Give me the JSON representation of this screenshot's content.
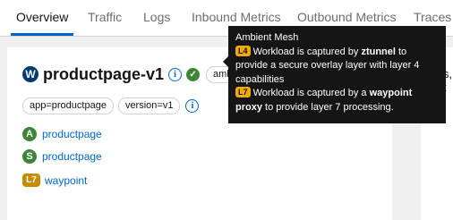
{
  "tabs": [
    {
      "label": "Overview",
      "active": true
    },
    {
      "label": "Traffic"
    },
    {
      "label": "Logs"
    },
    {
      "label": "Inbound Metrics"
    },
    {
      "label": "Outbound Metrics"
    },
    {
      "label": "Traces"
    }
  ],
  "workload": {
    "badge": "W",
    "name": "productpage-v1",
    "info_icon": "i",
    "status_icon": "✓",
    "ambient_label": "ambient",
    "labels": [
      "app=productpage",
      "version=v1"
    ]
  },
  "services": [
    {
      "badge": "A",
      "name": "productpage"
    },
    {
      "badge": "S",
      "name": "productpage"
    },
    {
      "badge": "L7",
      "name": "waypoint"
    }
  ],
  "tooltip": {
    "title": "Ambient Mesh",
    "l4_badge": "L4",
    "l4_pre": "Workload is captured by ",
    "l4_bold": "ztunnel",
    "l4_post": " to provide a secure overlay layer with layer 4 capabilities",
    "l7_badge": "L7",
    "l7_pre": "Workload is captured by a ",
    "l7_bold": "waypoint proxy",
    "l7_post": " to provide layer 7 processing."
  },
  "right_partial_text": "s, t",
  "colors": {
    "accent": "#0066cc",
    "service_green": "#3e8635",
    "waypoint_gold": "#c58c00",
    "workload_navy": "#003a70",
    "tooltip_bg": "#151515"
  }
}
